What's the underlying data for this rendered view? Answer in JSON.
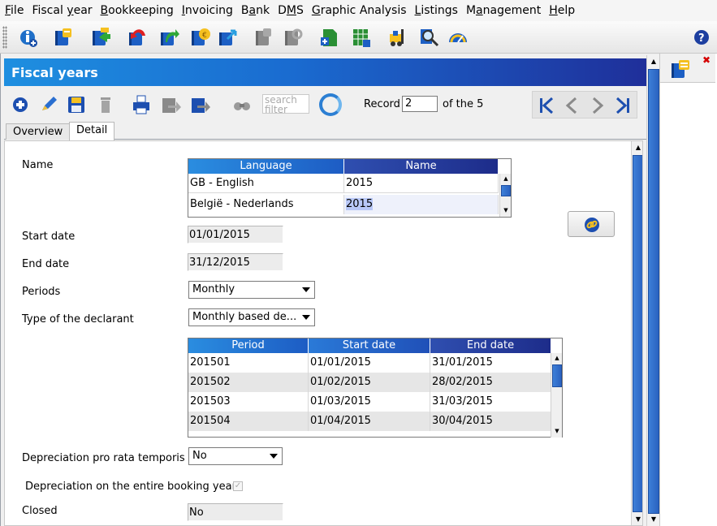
{
  "menu": [
    {
      "pre": "",
      "ul": "F",
      "post": "ile"
    },
    {
      "pre": "Fiscal ",
      "ul": "y",
      "post": "ear"
    },
    {
      "pre": "",
      "ul": "B",
      "post": "ookkeeping"
    },
    {
      "pre": "",
      "ul": "I",
      "post": "nvoicing"
    },
    {
      "pre": "B",
      "ul": "a",
      "post": "nk"
    },
    {
      "pre": "D",
      "ul": "M",
      "post": "S"
    },
    {
      "pre": "",
      "ul": "G",
      "post": "raphic Analysis"
    },
    {
      "pre": "",
      "ul": "L",
      "post": "istings"
    },
    {
      "pre": "M",
      "ul": "a",
      "post": "nagement"
    },
    {
      "pre": "",
      "ul": "H",
      "post": "elp"
    }
  ],
  "window": {
    "title": "Fiscal years"
  },
  "actionbar": {
    "search_placeholder": "search filter",
    "record_label": "Record",
    "record_value": "2",
    "of_label": "of the 5"
  },
  "tabs": [
    "Overview",
    "Detail"
  ],
  "detail": {
    "name_label": "Name",
    "name_grid": {
      "columns": [
        "Language",
        "Name"
      ],
      "rows": [
        [
          "GB - English",
          "2015"
        ],
        [
          "België - Nederlands",
          "2015"
        ]
      ]
    },
    "start_date_label": "Start date",
    "start_date": "01/01/2015",
    "end_date_label": "End date",
    "end_date": "31/12/2015",
    "periods_label": "Periods",
    "periods_value": "Monthly",
    "declarant_label": "Type of the declarant",
    "declarant_value": "Monthly based de...",
    "period_grid": {
      "columns": [
        "Period",
        "Start date",
        "End date"
      ],
      "rows": [
        [
          "201501",
          "01/01/2015",
          "31/01/2015"
        ],
        [
          "201502",
          "01/02/2015",
          "28/02/2015"
        ],
        [
          "201503",
          "01/03/2015",
          "31/03/2015"
        ],
        [
          "201504",
          "01/04/2015",
          "30/04/2015"
        ]
      ]
    },
    "depreciation_label": "Depreciation pro rata temporis",
    "depreciation_value": "No",
    "entire_year_label": "Depreciation on the entire booking year",
    "entire_year_checked": true,
    "closed_label": "Closed",
    "closed_value": "No"
  },
  "icons": {
    "toolbar": [
      "info-add-icon",
      "notebook-icon",
      "notebook-export-icon",
      "notebook-undo-icon",
      "notebook-forward-icon",
      "notebook-money-icon",
      "notebook-transfer-icon",
      "notebook-gray-icon",
      "notebook-gray-link-icon",
      "document-add-icon",
      "spreadsheet-add-icon",
      "forklift-icon",
      "zoom-report-icon",
      "gauge-icon",
      "help-icon"
    ],
    "side_tab": "notebook-tab-icon"
  },
  "colors": {
    "title_gradient_start": "#1e8fe0",
    "title_gradient_end": "#1f2f9a",
    "grid_header": "#2a8de0",
    "scroll_thumb": "#2a62c0",
    "close_red": "#d40000"
  }
}
